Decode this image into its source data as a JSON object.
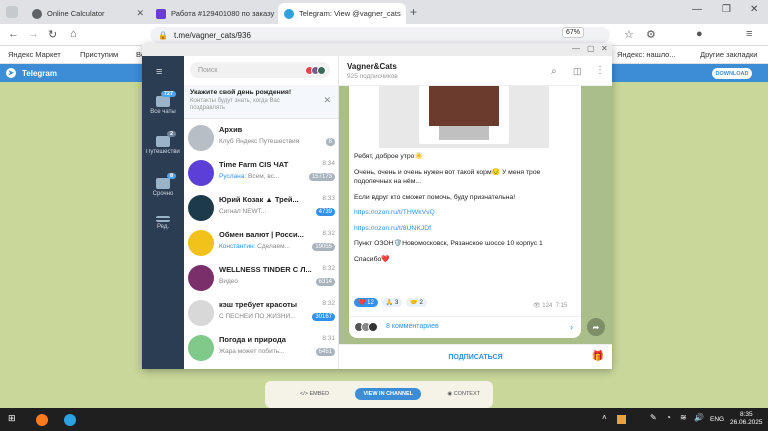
{
  "browser": {
    "tabs": [
      {
        "title": "Online Calculator",
        "color": "#5f6368"
      },
      {
        "title": "Работа #129401080 по заказу",
        "color": "#6a3bd6"
      },
      {
        "title": "Telegram: View @vagner_cats",
        "color": "#2aa3e0"
      }
    ],
    "url": "t.me/vagner_cats/936",
    "zoom": "67%",
    "bookmarks": [
      "Яндекс Маркет",
      "Приступим",
      "Во",
      "Яндекс: нашло...",
      "Другие закладки"
    ]
  },
  "tg_page": {
    "header_title": "Telegram",
    "download_label": "DOWNLOAD",
    "embed_label": "EMBED",
    "view_in_channel_label": "VIEW IN CHANNEL",
    "context_label": "CONTEXT"
  },
  "rail": [
    {
      "label": "Все чаты",
      "badge": "727"
    },
    {
      "label": "Путешествия",
      "badge": "2"
    },
    {
      "label": "Срочно",
      "badge": "8"
    },
    {
      "label": "Ред.",
      "badge": ""
    }
  ],
  "search": {
    "placeholder": "Поиск"
  },
  "banner": {
    "title": "Укажите свой день рождения!",
    "subtitle": "Контакты будут знать, когда Вас поздравлять"
  },
  "chats": [
    {
      "title": "Архив",
      "time": "",
      "sender": "",
      "preview": "Клуб Яндекс Путешествия...",
      "badge": "8",
      "avatar": "#b8bec6",
      "badge_blue": false
    },
    {
      "title": "Time Farm CIS ЧАТ",
      "time": "8:34",
      "sender": "Руслана:",
      "preview": "Всем, вс...",
      "badge": "157173",
      "avatar": "#5b3fd6",
      "badge_blue": false
    },
    {
      "title": "Юрий Козак ▲ Трей...",
      "time": "8:33",
      "sender": "",
      "preview": "Сигнал NEWT...",
      "badge": "4739",
      "avatar": "#1d3a4a",
      "badge_blue": true
    },
    {
      "title": "Обмен валют | Росси...",
      "time": "8:32",
      "sender": "Константин:",
      "preview": "Сделаем...",
      "badge": "19055",
      "avatar": "#f2c21a",
      "badge_blue": false
    },
    {
      "title": "WELLNESS TINDER С Л...",
      "time": "8:32",
      "sender": "",
      "preview": "Видео",
      "badge": "6314",
      "avatar": "#7a2f6a",
      "badge_blue": false
    },
    {
      "title": "кэш требует красоты",
      "time": "8:32",
      "sender": "",
      "preview": "С ПЕСНЕЙ ПО ЖИЗНИ...",
      "badge": "30167",
      "avatar": "#d8d8d8",
      "badge_blue": true
    },
    {
      "title": "Погода и природа",
      "time": "8:31",
      "sender": "",
      "preview": "Жара может побить...",
      "badge": "6451",
      "avatar": "#7fc98a",
      "badge_blue": false
    }
  ],
  "channel": {
    "name": "Vagner&Cats",
    "subscribers": "925 подписчиков",
    "subscribe_label": "ПОДПИСАТЬСЯ",
    "post": {
      "lines": [
        "Ребят, доброе утро☀️",
        "Очень, очень и очень нужен вот такой корм😔 У меня трое подопечных на нём...",
        "Если вдруг кто сможет помочь, буду признательна!",
        "https://ozon.ru/t/THWkVvQ",
        "https://ozon.ru/t/8UNKJDf",
        "Пункт ОЗОН🛡️Новомосковск, Рязанское шоссе 10 корпус 1",
        "Спасибо❤️"
      ],
      "reactions": [
        {
          "emoji": "❤️",
          "count": "12"
        },
        {
          "emoji": "🙏",
          "count": "3"
        },
        {
          "emoji": "🤝",
          "count": "2"
        }
      ],
      "views": "124",
      "time": "7:15",
      "comments_label": "8 комментариев"
    }
  },
  "taskbar": {
    "lang": "ENG",
    "time": "8:35",
    "date": "26.06.2025"
  }
}
